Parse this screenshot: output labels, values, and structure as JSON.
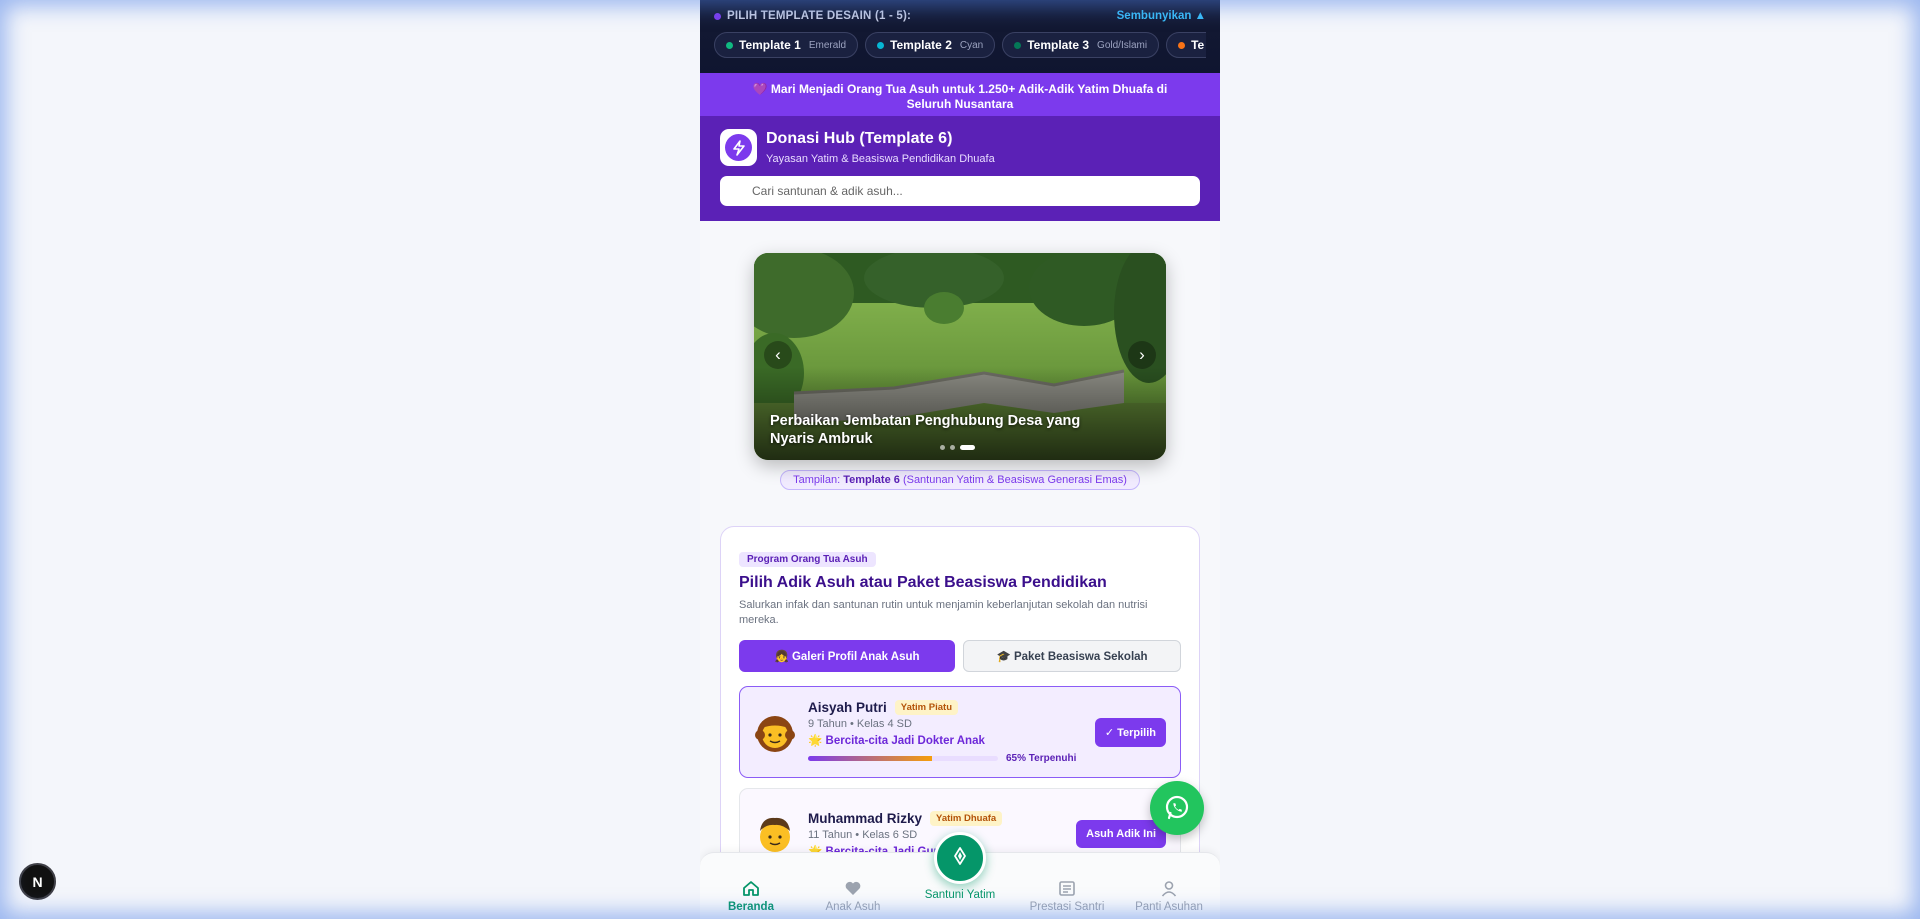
{
  "picker": {
    "title": "PILIH TEMPLATE DESAIN (1 - 5):",
    "hide_label": "Sembunyikan ▲",
    "chips": [
      {
        "name": "Template 1",
        "sub": "Emerald",
        "color": "#10b981"
      },
      {
        "name": "Template 2",
        "sub": "Cyan",
        "color": "#06b6d4"
      },
      {
        "name": "Template 3",
        "sub": "Gold/Islami",
        "color": "#047857"
      },
      {
        "name": "Te",
        "sub": "",
        "color": "#f97316"
      }
    ]
  },
  "banner": {
    "text": "💜 Mari Menjadi Orang Tua Asuh untuk 1.250+ Adik-Adik Yatim Dhuafa di Seluruh Nusantara"
  },
  "header": {
    "app_name": "Donasi Hub (Template 6)",
    "subtitle": "Yayasan Yatim & Beasiswa Pendidikan Dhuafa",
    "search_placeholder": "Cari santunan & adik asuh..."
  },
  "carousel": {
    "caption": "Perbaikan Jembatan Penghubung Desa yang Nyaris Ambruk",
    "prev": "‹",
    "next": "›"
  },
  "tampilan": {
    "prefix": "Tampilan:",
    "template": "Template 6",
    "suffix": "(Santunan Yatim & Beasiswa Generasi Emas)"
  },
  "program": {
    "tag": "Program Orang Tua Asuh",
    "title": "Pilih Adik Asuh atau Paket Beasiswa Pendidikan",
    "desc": "Salurkan infak dan santunan rutin untuk menjamin keberlanjutan sekolah dan nutrisi mereka.",
    "tab_gallery": "👧 Galeri Profil Anak Asuh",
    "tab_package": "🎓 Paket Beasiswa Sekolah",
    "children": [
      {
        "name": "Aisyah Putri",
        "badge": "Yatim Piatu",
        "meta": "9 Tahun • Kelas 4 SD",
        "dream": "🌟 Bercita-cita Jadi Dokter Anak",
        "progress": 0.65,
        "progress_label": "65% Terpenuhi",
        "button": "✓ Terpilih"
      },
      {
        "name": "Muhammad Rizky",
        "badge": "Yatim Dhuafa",
        "meta": "11 Tahun • Kelas 6 SD",
        "dream": "🌟 Bercita-cita Jadi Guru",
        "button": "Asuh Adik Ini"
      }
    ]
  },
  "nav": {
    "items": [
      "Beranda",
      "Anak Asuh",
      "Santuni Yatim",
      "Prestasi Santri",
      "Panti Asuhan"
    ]
  },
  "next_badge": "N"
}
